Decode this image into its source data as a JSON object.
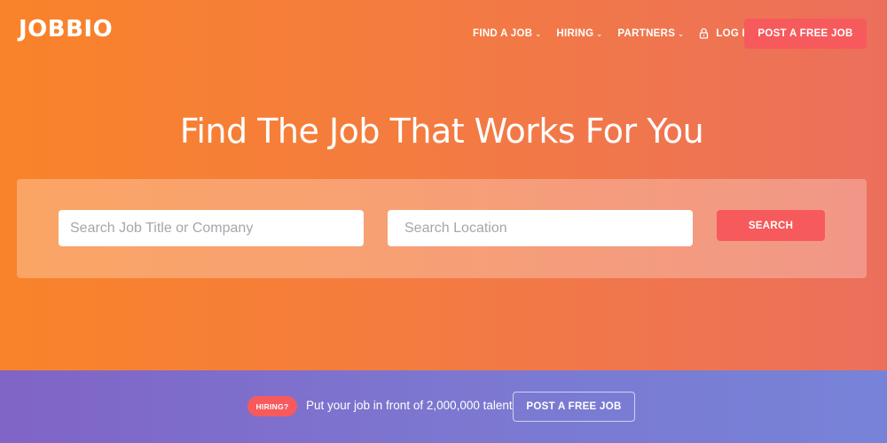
{
  "brand": {
    "logo_text": "JOBBIO"
  },
  "nav": {
    "items": [
      {
        "label": "FIND A JOB",
        "icon": "chevron-down-icon"
      },
      {
        "label": "HIRING",
        "icon": "chevron-down-icon"
      },
      {
        "label": "PARTNERS",
        "icon": "chevron-down-icon"
      }
    ],
    "login": {
      "label": "LOG IN",
      "icon": "lock-icon"
    },
    "post_job_label": "POST A FREE JOB"
  },
  "hero": {
    "headline": "Find The Job That Works For You",
    "search": {
      "job_placeholder": "Search Job Title or Company",
      "job_value": "",
      "location_placeholder": "Search Location",
      "location_value": "",
      "button_label": "SEARCH"
    }
  },
  "banner": {
    "badge": "HIRING?",
    "text": "Put your job in front of 2,000,000 talent",
    "button_label": "POST A FREE JOB"
  },
  "colors": {
    "accent": "#f75a5c",
    "hero_gradient_start": "#f9832a",
    "hero_gradient_end": "#ec6f5c",
    "banner_gradient_start": "#8064c6",
    "banner_gradient_end": "#7783d8"
  }
}
